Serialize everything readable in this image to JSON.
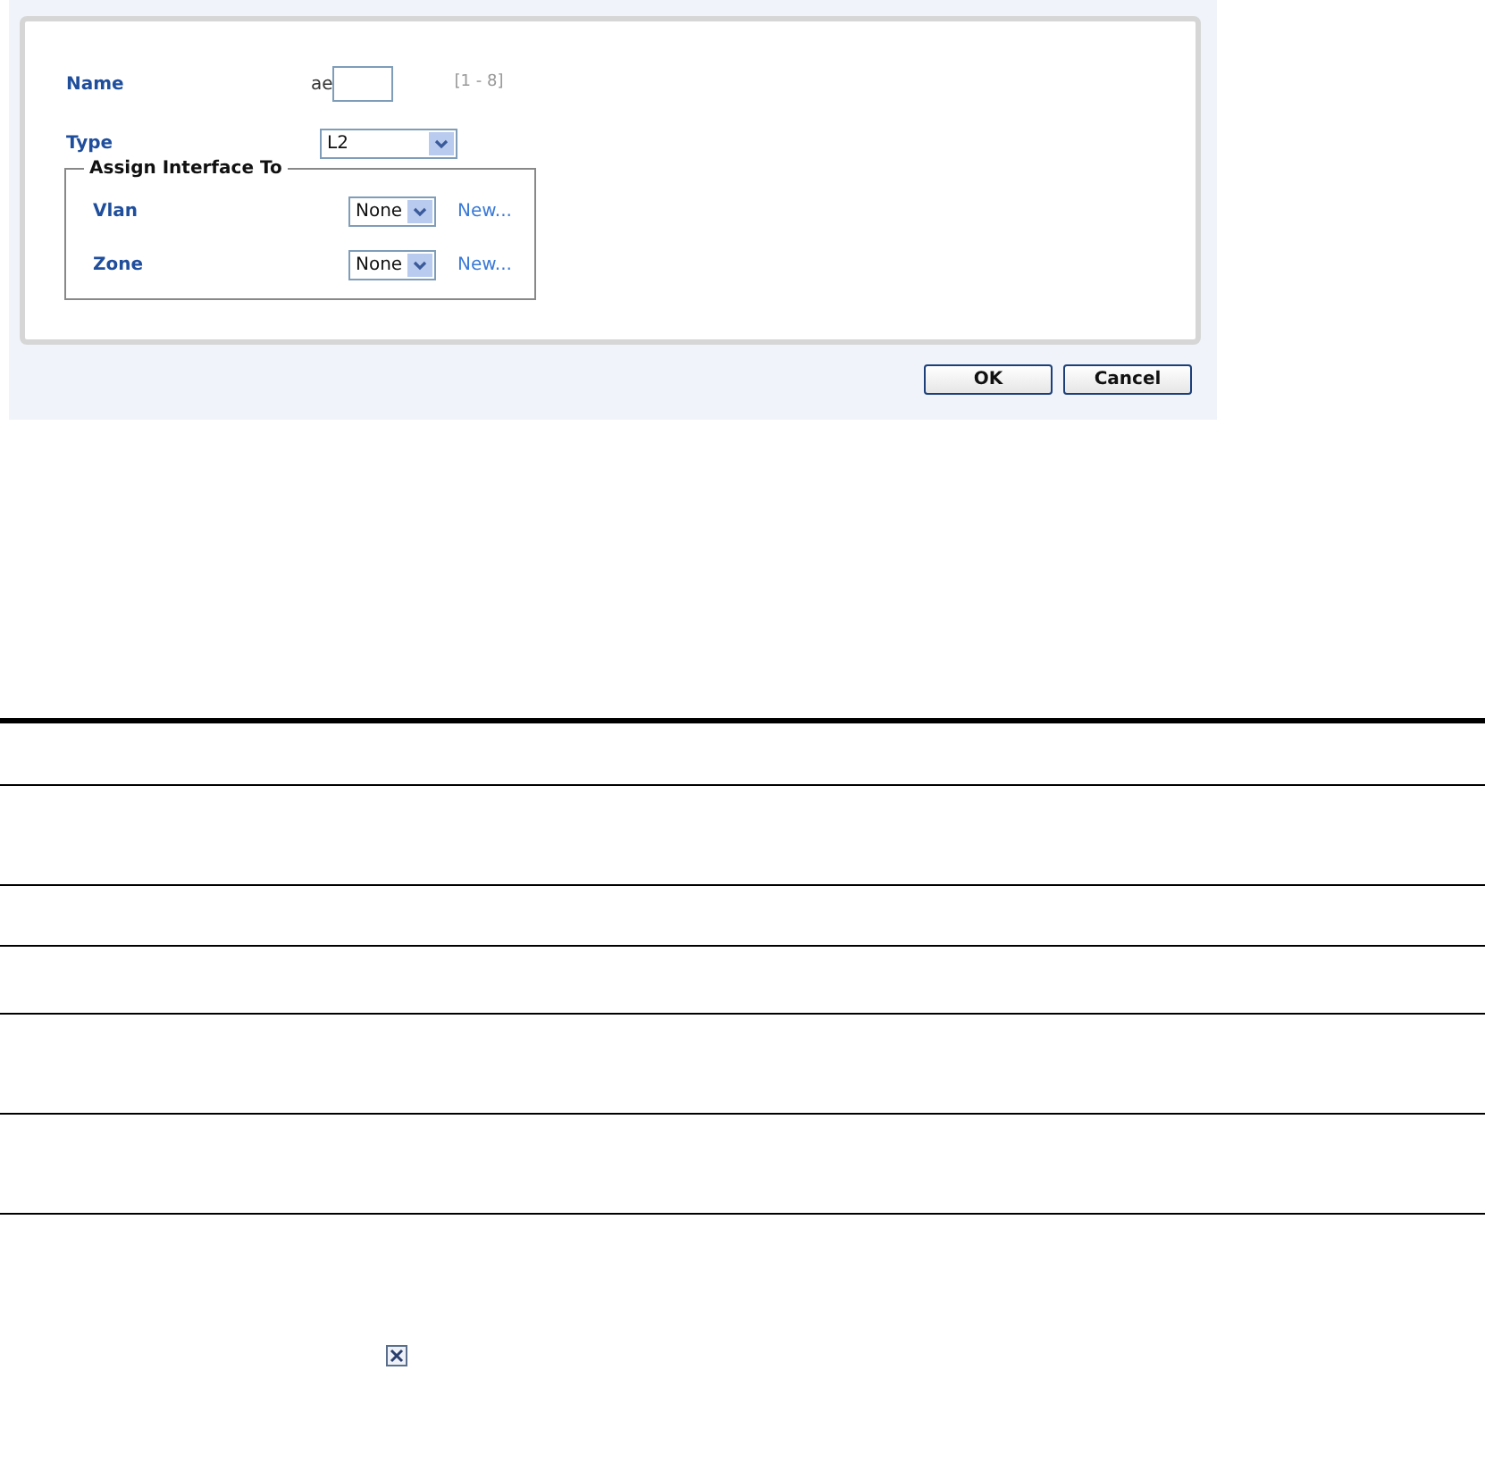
{
  "form": {
    "name": {
      "label": "Name",
      "prefix": "ae",
      "hint": "[1 - 8]"
    },
    "type": {
      "label": "Type",
      "value": "L2"
    },
    "assign_group": {
      "legend": "Assign Interface To",
      "rows": [
        {
          "label": "Vlan",
          "value": "None",
          "link": "New..."
        },
        {
          "label": "Zone",
          "value": "None",
          "link": "New..."
        }
      ]
    }
  },
  "buttons": [
    {
      "label": "OK"
    },
    {
      "label": "Cancel"
    }
  ]
}
